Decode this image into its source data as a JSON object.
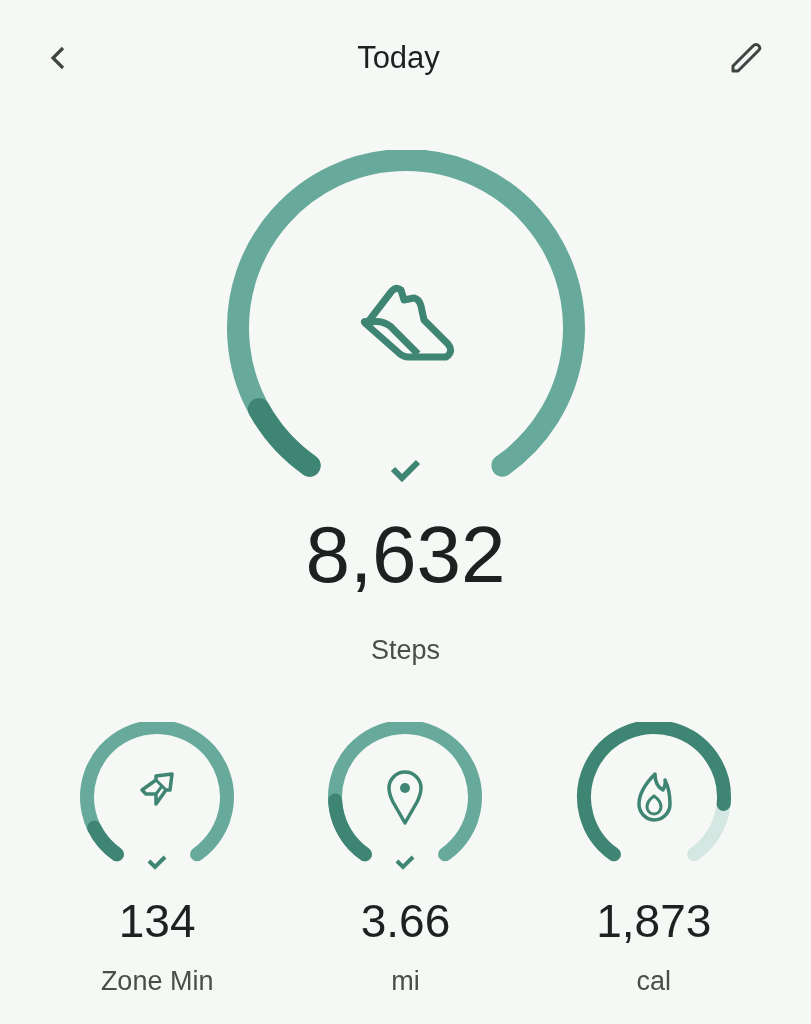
{
  "header": {
    "title": "Today"
  },
  "main": {
    "value": "8,632",
    "label": "Steps",
    "goal_met": true
  },
  "stats": [
    {
      "kind": "zone",
      "value": "134",
      "label": "Zone Min",
      "goal_met": true
    },
    {
      "kind": "distance",
      "value": "3.66",
      "label": "mi",
      "goal_met": true
    },
    {
      "kind": "calories",
      "value": "1,873",
      "label": "cal",
      "goal_met": false
    }
  ]
}
